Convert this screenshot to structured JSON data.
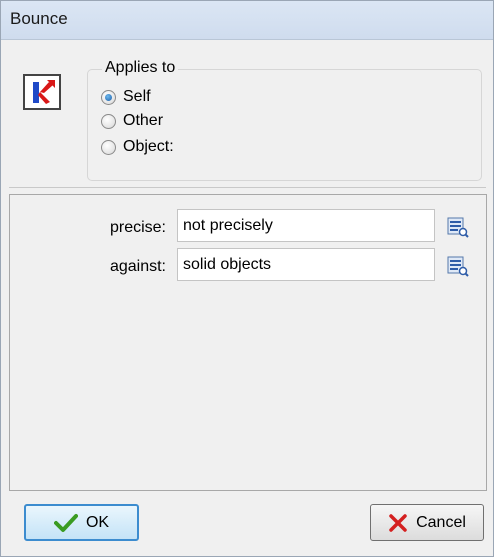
{
  "window": {
    "title": "Bounce"
  },
  "applies_to": {
    "legend": "Applies to",
    "options": [
      {
        "label": "Self",
        "checked": true
      },
      {
        "label": "Other",
        "checked": false
      },
      {
        "label": "Object:",
        "checked": false
      }
    ]
  },
  "params": [
    {
      "label": "precise:",
      "value": "not precisely"
    },
    {
      "label": "against:",
      "value": "solid objects"
    }
  ],
  "buttons": {
    "ok": "OK",
    "cancel": "Cancel"
  },
  "icons": {
    "action": "bounce-action-icon",
    "browse": "browse-menu-icon",
    "ok": "checkmark-icon",
    "cancel": "red-x-icon"
  },
  "colors": {
    "accent": "#3c8ccf",
    "ok_check": "#3a9b22",
    "cancel_x": "#d42020"
  }
}
